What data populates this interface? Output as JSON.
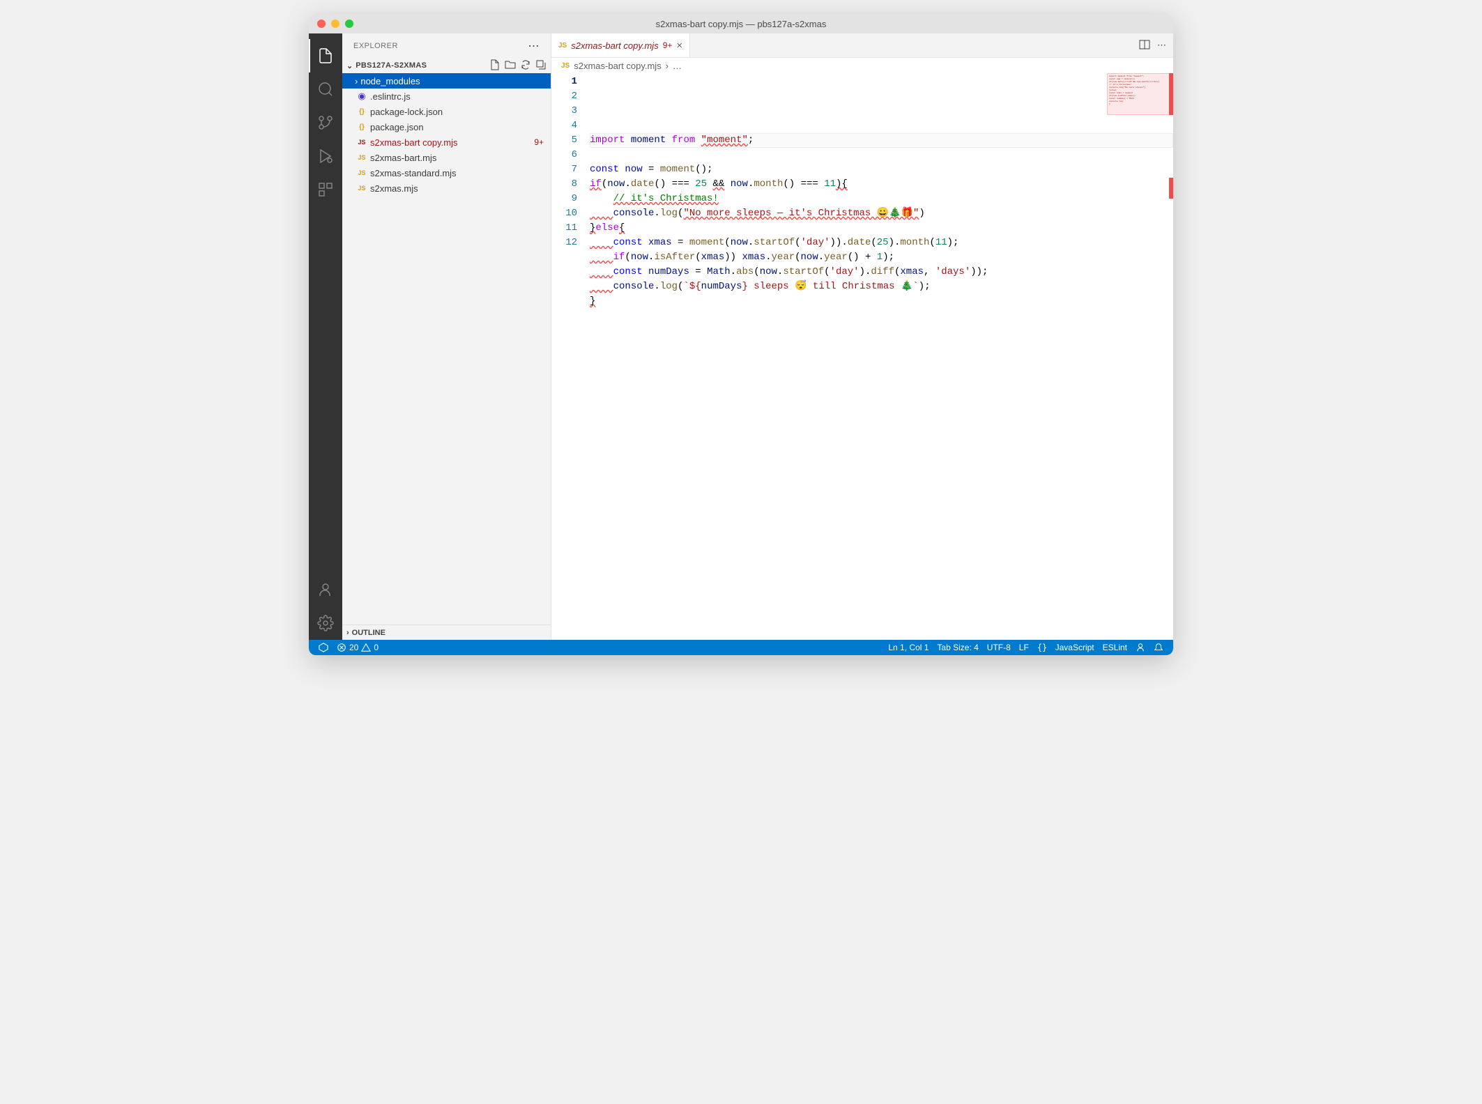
{
  "window_title": "s2xmas-bart copy.mjs — pbs127a-s2xmas",
  "sidebar": {
    "title": "EXPLORER",
    "project": "PBS127A-S2XMAS",
    "outline": "OUTLINE",
    "items": [
      {
        "name": "node_modules",
        "type": "folder",
        "selected": true
      },
      {
        "name": ".eslintrc.js",
        "type": "eslint"
      },
      {
        "name": "package-lock.json",
        "type": "json"
      },
      {
        "name": "package.json",
        "type": "json"
      },
      {
        "name": "s2xmas-bart copy.mjs",
        "type": "js",
        "modified": true,
        "badge": "9+"
      },
      {
        "name": "s2xmas-bart.mjs",
        "type": "js"
      },
      {
        "name": "s2xmas-standard.mjs",
        "type": "js"
      },
      {
        "name": "s2xmas.mjs",
        "type": "js"
      }
    ]
  },
  "tab": {
    "label": "s2xmas-bart copy.mjs",
    "badge": "9+"
  },
  "breadcrumb": {
    "file": "s2xmas-bart copy.mjs",
    "rest": "…"
  },
  "code_lines": [
    {
      "n": 1,
      "tokens": [
        [
          "kw",
          "import"
        ],
        [
          "sp",
          " "
        ],
        [
          "var",
          "moment"
        ],
        [
          "sp",
          " "
        ],
        [
          "kw",
          "from"
        ],
        [
          "sp",
          " "
        ],
        [
          "str",
          "\"moment\"",
          "err"
        ],
        [
          "op",
          ";"
        ]
      ],
      "hl": true
    },
    {
      "n": 2,
      "tokens": []
    },
    {
      "n": 3,
      "tokens": [
        [
          "kw2",
          "const"
        ],
        [
          "sp",
          " "
        ],
        [
          "var",
          "now"
        ],
        [
          "sp",
          " "
        ],
        [
          "op",
          "="
        ],
        [
          "sp",
          " "
        ],
        [
          "fn",
          "moment"
        ],
        [
          "op",
          "();"
        ]
      ]
    },
    {
      "n": 4,
      "tokens": [
        [
          "kw",
          "if",
          "err"
        ],
        [
          "op",
          "("
        ],
        [
          "var",
          "now"
        ],
        [
          "op",
          "."
        ],
        [
          "fn",
          "date"
        ],
        [
          "op",
          "()"
        ],
        [
          "sp",
          " "
        ],
        [
          "op",
          "==="
        ],
        [
          "sp",
          " "
        ],
        [
          "num",
          "25"
        ],
        [
          "sp",
          " "
        ],
        [
          "op",
          "&&",
          "err"
        ],
        [
          "sp",
          " "
        ],
        [
          "var",
          "now"
        ],
        [
          "op",
          "."
        ],
        [
          "fn",
          "month"
        ],
        [
          "op",
          "()"
        ],
        [
          "sp",
          " "
        ],
        [
          "op",
          "==="
        ],
        [
          "sp",
          " "
        ],
        [
          "num",
          "11"
        ],
        [
          "op",
          "){",
          "err"
        ]
      ]
    },
    {
      "n": 5,
      "tokens": [
        [
          "sp",
          "    "
        ],
        [
          "cmt",
          "// it's Christmas!",
          "err"
        ]
      ]
    },
    {
      "n": 6,
      "tokens": [
        [
          "sp",
          "    ",
          "err"
        ],
        [
          "var",
          "console"
        ],
        [
          "op",
          "."
        ],
        [
          "fn",
          "log"
        ],
        [
          "op",
          "("
        ],
        [
          "str",
          "\"No more sleeps — it's Christmas 😀🎄🎁\"",
          "err"
        ],
        [
          "op",
          ")"
        ]
      ]
    },
    {
      "n": 7,
      "tokens": [
        [
          "op",
          "}",
          "err"
        ],
        [
          "kw",
          "else"
        ],
        [
          "op",
          "{",
          "err"
        ]
      ]
    },
    {
      "n": 8,
      "tokens": [
        [
          "sp",
          "    ",
          "err"
        ],
        [
          "kw2",
          "const"
        ],
        [
          "sp",
          " "
        ],
        [
          "var",
          "xmas"
        ],
        [
          "sp",
          " "
        ],
        [
          "op",
          "="
        ],
        [
          "sp",
          " "
        ],
        [
          "fn",
          "moment"
        ],
        [
          "op",
          "("
        ],
        [
          "var",
          "now"
        ],
        [
          "op",
          "."
        ],
        [
          "fn",
          "startOf"
        ],
        [
          "op",
          "("
        ],
        [
          "str",
          "'day'"
        ],
        [
          "op",
          "))."
        ],
        [
          "fn",
          "date"
        ],
        [
          "op",
          "("
        ],
        [
          "num",
          "25"
        ],
        [
          "op",
          ")."
        ],
        [
          "fn",
          "month"
        ],
        [
          "op",
          "("
        ],
        [
          "num",
          "11"
        ],
        [
          "op",
          ");"
        ]
      ]
    },
    {
      "n": 9,
      "tokens": [
        [
          "sp",
          "    ",
          "err"
        ],
        [
          "kw",
          "if"
        ],
        [
          "op",
          "("
        ],
        [
          "var",
          "now"
        ],
        [
          "op",
          "."
        ],
        [
          "fn",
          "isAfter"
        ],
        [
          "op",
          "("
        ],
        [
          "var",
          "xmas"
        ],
        [
          "op",
          "))"
        ],
        [
          "sp",
          " "
        ],
        [
          "var",
          "xmas"
        ],
        [
          "op",
          "."
        ],
        [
          "fn",
          "year"
        ],
        [
          "op",
          "("
        ],
        [
          "var",
          "now"
        ],
        [
          "op",
          "."
        ],
        [
          "fn",
          "year"
        ],
        [
          "op",
          "()"
        ],
        [
          "sp",
          " "
        ],
        [
          "op",
          "+"
        ],
        [
          "sp",
          " "
        ],
        [
          "num",
          "1"
        ],
        [
          "op",
          ");"
        ]
      ]
    },
    {
      "n": 10,
      "tokens": [
        [
          "sp",
          "    ",
          "err"
        ],
        [
          "kw2",
          "const"
        ],
        [
          "sp",
          " "
        ],
        [
          "var",
          "numDays"
        ],
        [
          "sp",
          " "
        ],
        [
          "op",
          "="
        ],
        [
          "sp",
          " "
        ],
        [
          "var",
          "Math"
        ],
        [
          "op",
          "."
        ],
        [
          "fn",
          "abs"
        ],
        [
          "op",
          "("
        ],
        [
          "var",
          "now"
        ],
        [
          "op",
          "."
        ],
        [
          "fn",
          "startOf"
        ],
        [
          "op",
          "("
        ],
        [
          "str",
          "'day'"
        ],
        [
          "op",
          ")."
        ],
        [
          "fn",
          "diff"
        ],
        [
          "op",
          "("
        ],
        [
          "var",
          "xmas"
        ],
        [
          "op",
          ","
        ],
        [
          "sp",
          " "
        ],
        [
          "str",
          "'days'"
        ],
        [
          "op",
          "));"
        ]
      ]
    },
    {
      "n": 11,
      "tokens": [
        [
          "sp",
          "    ",
          "err"
        ],
        [
          "var",
          "console"
        ],
        [
          "op",
          "."
        ],
        [
          "fn",
          "log"
        ],
        [
          "op",
          "("
        ],
        [
          "str",
          "`${"
        ],
        [
          "var",
          "numDays"
        ],
        [
          "str",
          "} sleeps 😴 till Christmas 🎄`"
        ],
        [
          "op",
          ");"
        ]
      ]
    },
    {
      "n": 12,
      "tokens": [
        [
          "op",
          "}",
          "err"
        ]
      ]
    }
  ],
  "statusbar": {
    "errors": "20",
    "warnings": "0",
    "cursor": "Ln 1, Col 1",
    "tabsize": "Tab Size: 4",
    "encoding": "UTF-8",
    "eol": "LF",
    "lang": "JavaScript",
    "linter": "ESLint"
  }
}
